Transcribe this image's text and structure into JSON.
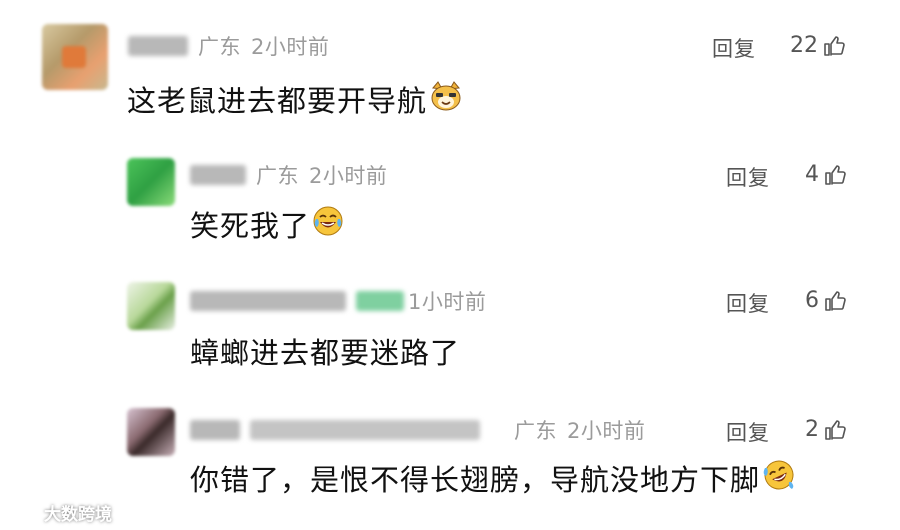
{
  "comments": [
    {
      "location": "广东",
      "time": "2小时前",
      "reply_label": "回复",
      "likes": "22",
      "text": "这老鼠进去都要开导航",
      "emoji_icon": "cat-face-emoji"
    },
    {
      "location": "广东",
      "time": "2小时前",
      "reply_label": "回复",
      "likes": "4",
      "text": "笑死我了",
      "emoji_icon": "tears-of-joy-emoji"
    },
    {
      "location": "",
      "time": "1小时前",
      "reply_label": "回复",
      "likes": "6",
      "text": "蟑螂进去都要迷路了"
    },
    {
      "location": "广东",
      "time": "2小时前",
      "reply_label": "回复",
      "likes": "2",
      "text": "你错了，是恨不得长翅膀，导航没地方下脚",
      "emoji_icon": "rolling-laughing-emoji"
    }
  ],
  "watermark": {
    "text": "大数跨境"
  },
  "colors": {
    "meta_gray": "#9b9b9b",
    "action_gray": "#555555",
    "text_black": "#111111"
  }
}
